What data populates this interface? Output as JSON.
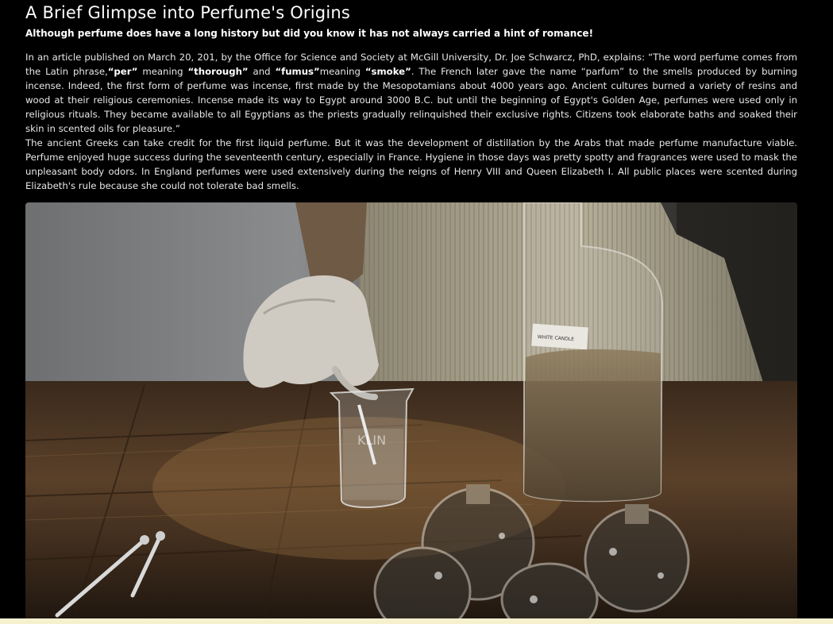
{
  "article": {
    "title": "A Brief Glimpse into Perfume's Origins",
    "subtitle": "Although perfume does have a long history but did you know it has not always carried a hint of romance!",
    "p1": {
      "seg1": "In an article published on March 20, 201, by the Office for Science and Society at McGill University, Dr. Joe Schwarcz, PhD, explains: “The word perfume comes from the Latin phrase,",
      "per": "“per”",
      "seg2": " meaning ",
      "thorough": "“thorough”",
      "seg3": " and ",
      "fumus": "“fumus”",
      "seg4": "meaning ",
      "smoke": "“smoke”",
      "seg5": ". The French later gave the name “parfum” to the smells produced by burning incense. Indeed, the first form of perfume was incense, first made by the Mesopotamians about 4000 years ago. Ancient cultures burned a variety of resins and wood at their religious ceremonies. Incense made its way to Egypt around 3000 B.C. but until the beginning of Egypt's Golden Age, perfumes were used only in religious rituals. They became available to all Egyptians as the priests gradually relinquished their exclusive rights. Citizens took elaborate baths and soaked their skin in scented oils for pleasure.”"
    },
    "p2": "The ancient Greeks can take credit for the first liquid perfume. But it was the development of distillation by the Arabs that made perfume manufacture viable. Perfume enjoyed huge success during the seventeenth century, especially in France. Hygiene in those days was pretty spotty and fragrances were used to mask the unpleasant body odors. In England perfumes were used extensively during the reigns of Henry VIII and Queen Elizabeth I. All public places were scented during Elizabeth's rule because she could not tolerate bad smells.",
    "image": {
      "alt_subject": "gloved hand stirring liquid in a beaker next to a large glass bottle",
      "bottle_label": "WHITE CANDLE",
      "beaker_mark": "KLIN"
    }
  },
  "colors": {
    "background": "#000000",
    "text": "#e8e8e8",
    "bottom_strip": "#f7f0cf"
  }
}
